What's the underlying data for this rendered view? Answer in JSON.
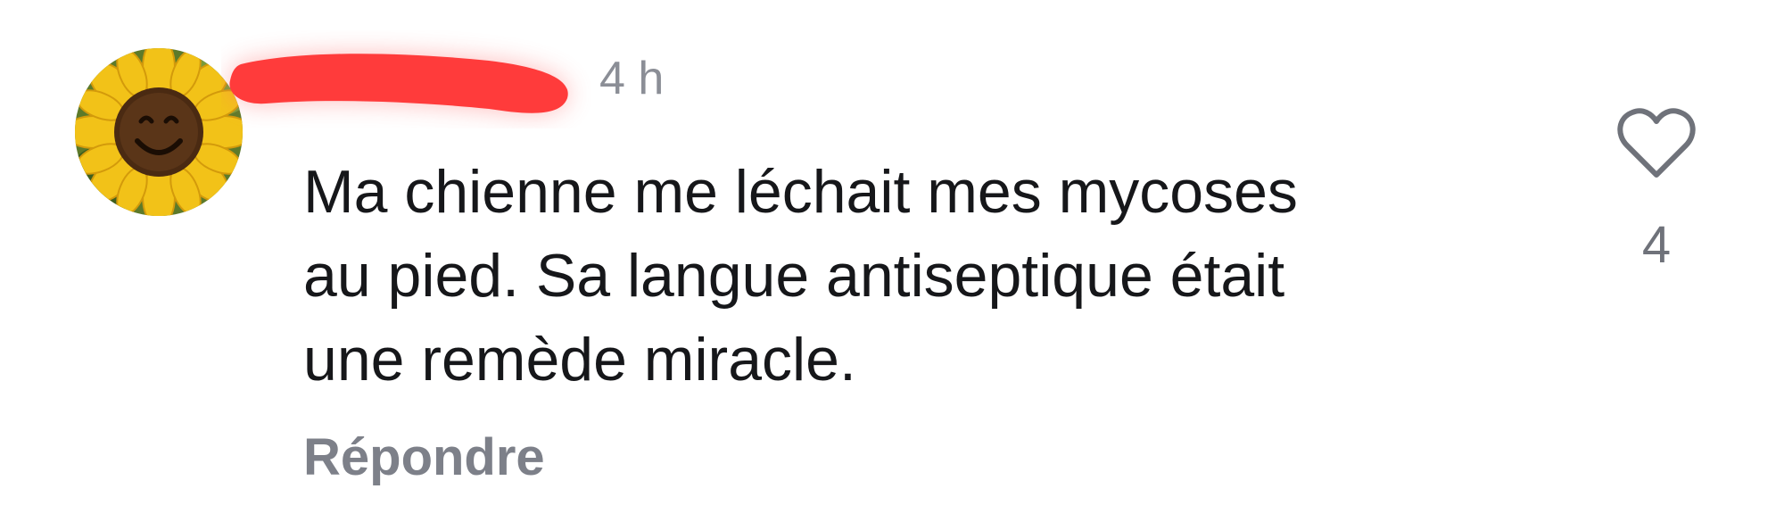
{
  "comment": {
    "timestamp": "4 h",
    "text_lines": [
      "Ma chienne me léchait mes mycoses",
      "au pied. Sa langue antiseptique était",
      "une remède miracle."
    ],
    "reply_label": "Répondre",
    "like_count": "4"
  },
  "icons": {
    "avatar": "sunflower-avatar",
    "like": "heart-outline-icon"
  },
  "colors": {
    "text": "#16171a",
    "muted": "#8b8e96",
    "redaction": "#ff3b3b"
  }
}
